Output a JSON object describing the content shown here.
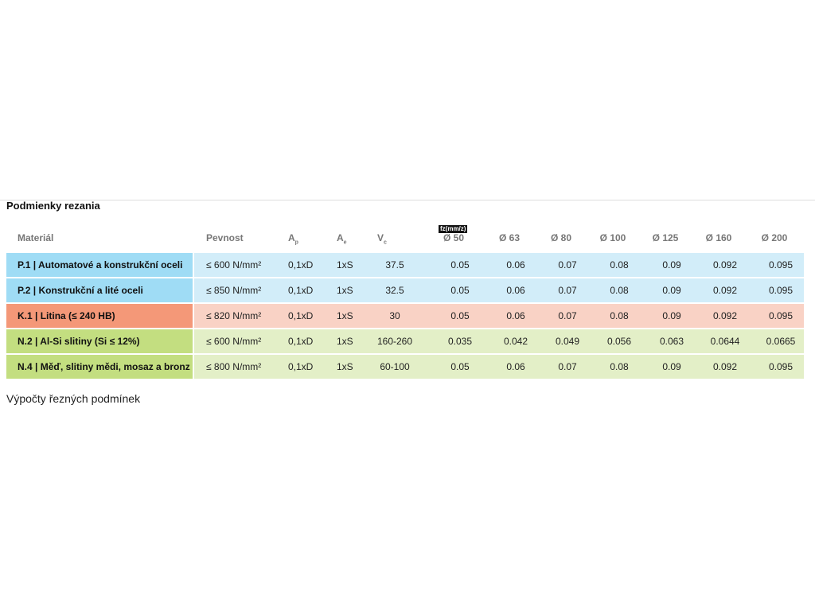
{
  "title": "Podmienky rezania",
  "fz_label": "fz(mm/z)",
  "headers": {
    "material": "Materiál",
    "strength": "Pevnost",
    "ap": "A",
    "ap_sub": "p",
    "ae": "A",
    "ae_sub": "e",
    "vc": "V",
    "vc_sub": "c",
    "diameters": [
      "Ø 50",
      "Ø 63",
      "Ø 80",
      "Ø 100",
      "Ø 125",
      "Ø 160",
      "Ø 200"
    ]
  },
  "rows": [
    {
      "material": "P.1 | Automatové a konstrukční oceli",
      "strength": "≤ 600 N/mm²",
      "ap": "0,1xD",
      "ae": "1xS",
      "vc": "37.5",
      "fz": [
        "0.05",
        "0.06",
        "0.07",
        "0.08",
        "0.09",
        "0.092",
        "0.095"
      ],
      "label_color": "#9fdcf5",
      "cell_color": "#d2edf9"
    },
    {
      "material": "P.2 | Konstrukční a lité oceli",
      "strength": "≤ 850 N/mm²",
      "ap": "0,1xD",
      "ae": "1xS",
      "vc": "32.5",
      "fz": [
        "0.05",
        "0.06",
        "0.07",
        "0.08",
        "0.09",
        "0.092",
        "0.095"
      ],
      "label_color": "#9fdcf5",
      "cell_color": "#d2edf9"
    },
    {
      "material": "K.1 | Litina (≤ 240 HB)",
      "strength": "≤ 820 N/mm²",
      "ap": "0,1xD",
      "ae": "1xS",
      "vc": "30",
      "fz": [
        "0.05",
        "0.06",
        "0.07",
        "0.08",
        "0.09",
        "0.092",
        "0.095"
      ],
      "label_color": "#f49878",
      "cell_color": "#f9d2c5"
    },
    {
      "material": "N.2 | Al-Si slitiny (Si ≤ 12%)",
      "strength": "≤ 600 N/mm²",
      "ap": "0,1xD",
      "ae": "1xS",
      "vc": "160-260",
      "fz": [
        "0.035",
        "0.042",
        "0.049",
        "0.056",
        "0.063",
        "0.0644",
        "0.0665"
      ],
      "label_color": "#c3de80",
      "cell_color": "#e3efc7"
    },
    {
      "material": "N.4 | Měď, slitiny mědi, mosaz a bronz",
      "strength": "≤ 800 N/mm²",
      "ap": "0,1xD",
      "ae": "1xS",
      "vc": "60-100",
      "fz": [
        "0.05",
        "0.06",
        "0.07",
        "0.08",
        "0.09",
        "0.092",
        "0.095"
      ],
      "label_color": "#c3de80",
      "cell_color": "#e3efc7"
    }
  ],
  "footer": "Výpočty řezných podmínek"
}
